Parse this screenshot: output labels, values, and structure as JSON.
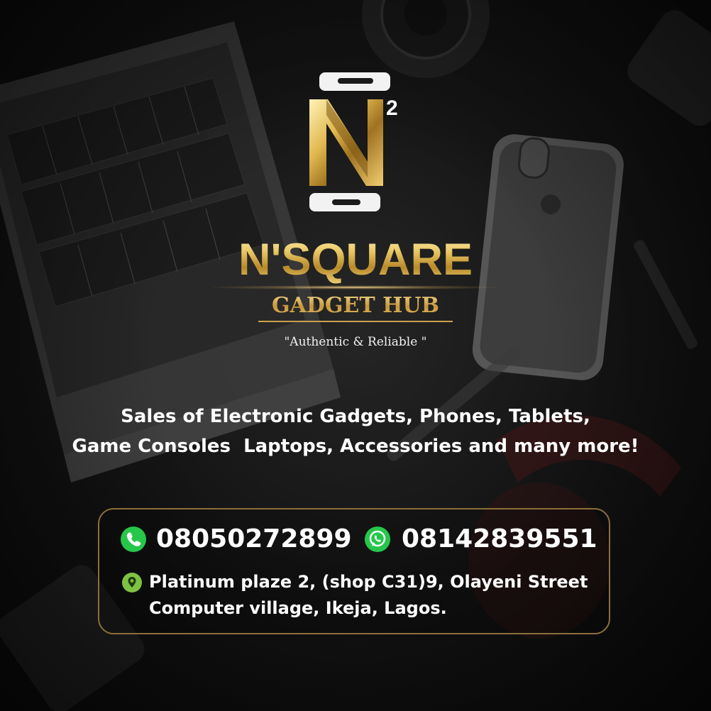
{
  "brand": {
    "logo_letter": "N",
    "logo_superscript": "2",
    "name": "N'SQUARE",
    "subtitle": "GADGET HUB",
    "tagline": "\"Authentic & Reliable \""
  },
  "services": {
    "line1": "Sales of Electronic Gadgets, Phones, Tablets,",
    "line2": "Game Consoles  Laptops, Accessories and many more!"
  },
  "contact": {
    "phone": "08050272899",
    "whatsapp": "08142839551",
    "address_line1": "Platinum plaze 2, (shop C31)9, Olayeni Street",
    "address_line2": "Computer village, Ikeja, Lagos."
  },
  "icons": {
    "phone": "phone-icon",
    "whatsapp": "whatsapp-icon",
    "location": "location-pin-icon"
  },
  "colors": {
    "gold": "#d8b24e",
    "gold_border": "#8b6f3a",
    "whatsapp_green": "#26c64a",
    "pin_green": "#7ec242",
    "text": "#ffffff"
  }
}
